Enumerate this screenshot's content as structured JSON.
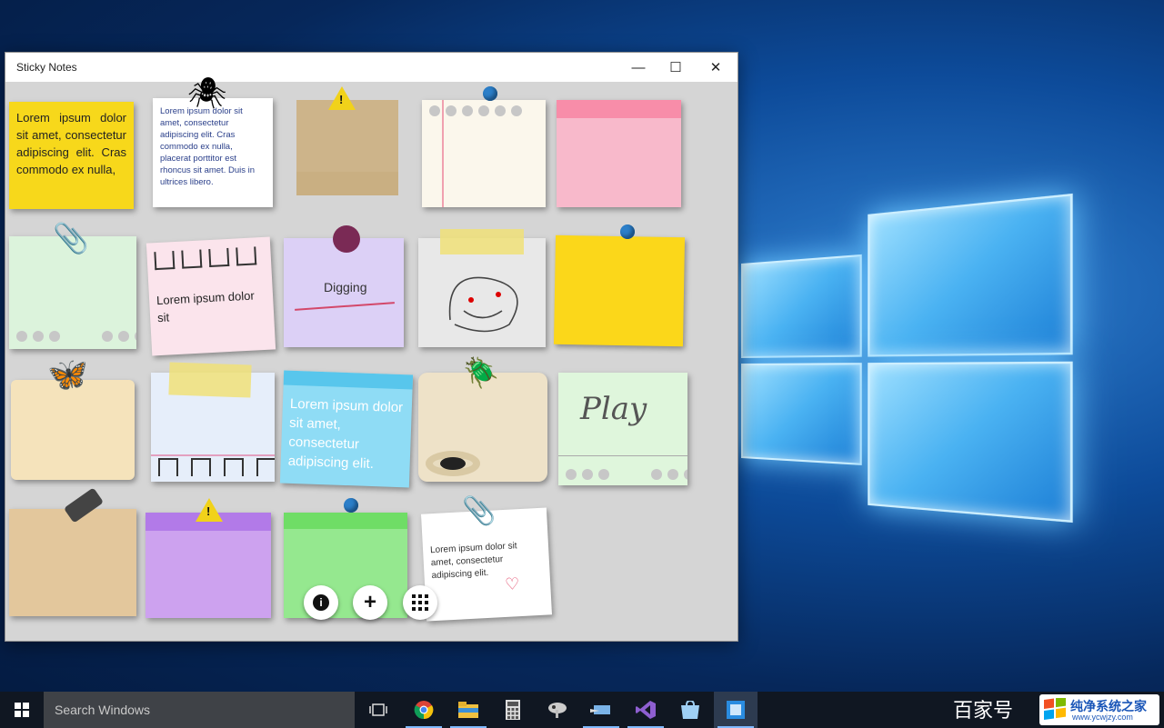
{
  "window": {
    "title": "Sticky Notes",
    "controls": {
      "minimize": "—",
      "maximize": "☐",
      "close": "✕"
    }
  },
  "notes": {
    "n1": "Lorem ipsum dolor sit amet, consectetur adipiscing elit. Cras commodo ex nulla,",
    "n2": "Lorem ipsum dolor sit amet, consectetur adipiscing elit. Cras commodo ex nulla, placerat porttitor est rhoncus sit amet. Duis in ultrices libero.",
    "n8": "Lorem ipsum dolor sit",
    "n9": "Digging",
    "n13": "Lorem ipsum dolor sit amet, consectetur adipiscing elit.",
    "n15": "Play",
    "n19": "Lorem ipsum dolor sit amet, consectetur adipiscing elit."
  },
  "toolbar": {
    "info": "i",
    "add": "+",
    "grid": "⋮⋮⋮"
  },
  "taskbar": {
    "search_placeholder": "Search Windows",
    "apps": [
      "task-view",
      "chrome",
      "file-explorer",
      "calculator",
      "paint",
      "snipping",
      "visual-studio",
      "store",
      "sticky-notes"
    ]
  },
  "watermark": {
    "left": "百家号",
    "brand": "纯净系统之家",
    "url": "www.ycwjzy.com"
  },
  "colors": {
    "accent": "#0078d7",
    "taskbar": "#101722"
  }
}
